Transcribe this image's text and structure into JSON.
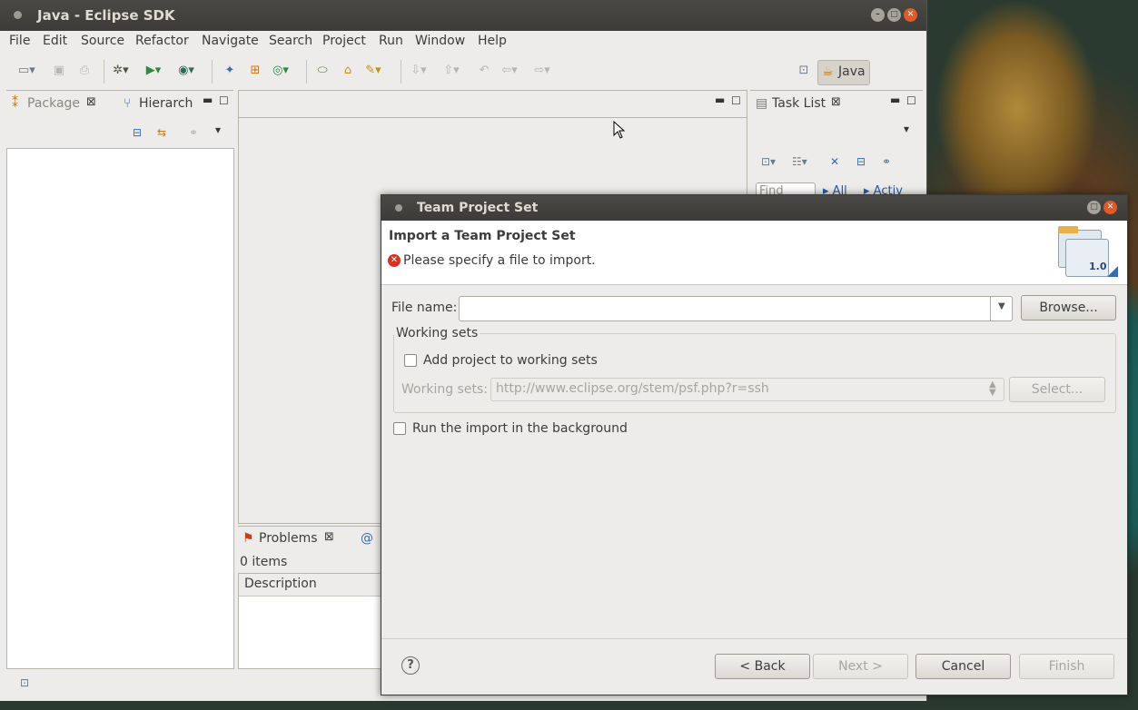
{
  "window": {
    "title": "Java - Eclipse SDK"
  },
  "menu": [
    "File",
    "Edit",
    "Source",
    "Refactor",
    "Navigate",
    "Search",
    "Project",
    "Run",
    "Window",
    "Help"
  ],
  "perspective": {
    "label": "Java"
  },
  "views": {
    "package_tab": "Package",
    "hierarchy_tab": "Hierarch",
    "tasklist_tab": "Task List",
    "tasklist_find": "Find",
    "tasklist_all": "All",
    "tasklist_activ": "Activ",
    "problems_tab": "Problems",
    "problems_count": "0 items",
    "problems_col_description": "Description"
  },
  "dialog": {
    "title": "Team Project Set",
    "heading": "Import a Team Project Set",
    "error_message": "Please specify a file to import.",
    "file_name_label": "File name:",
    "file_name_value": "",
    "browse_label": "Browse...",
    "working_sets_group": "Working sets",
    "add_project_label": "Add project to working sets",
    "add_project_checked": false,
    "working_sets_label": "Working sets:",
    "working_sets_value": "http://www.eclipse.org/stem/psf.php?r=ssh",
    "select_label": "Select...",
    "run_background_label": "Run the import in the background",
    "run_background_checked": false,
    "wizard_version_badge": "1.0",
    "help_symbol": "?",
    "back_label": "< Back",
    "next_label": "Next >",
    "cancel_label": "Cancel",
    "finish_label": "Finish"
  },
  "colors": {
    "accent_error": "#d9301f",
    "title_bar": "#3c3b37",
    "close_button": "#e2592a"
  }
}
